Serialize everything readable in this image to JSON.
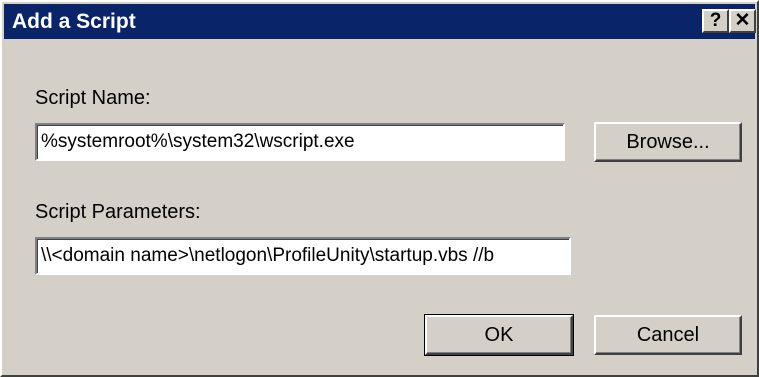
{
  "window": {
    "title": "Add a Script",
    "help_label": "?",
    "close_label": "✕"
  },
  "script_name": {
    "label": "Script Name:",
    "value": "%systemroot%\\system32\\wscript.exe"
  },
  "browse_button": {
    "label": "Browse..."
  },
  "script_parameters": {
    "label": "Script Parameters:",
    "value": "\\\\<domain name>\\netlogon\\ProfileUnity\\startup.vbs //b"
  },
  "buttons": {
    "ok": "OK",
    "cancel": "Cancel"
  },
  "colors": {
    "titlebar": "#0a246a",
    "face": "#d4d0c8"
  }
}
